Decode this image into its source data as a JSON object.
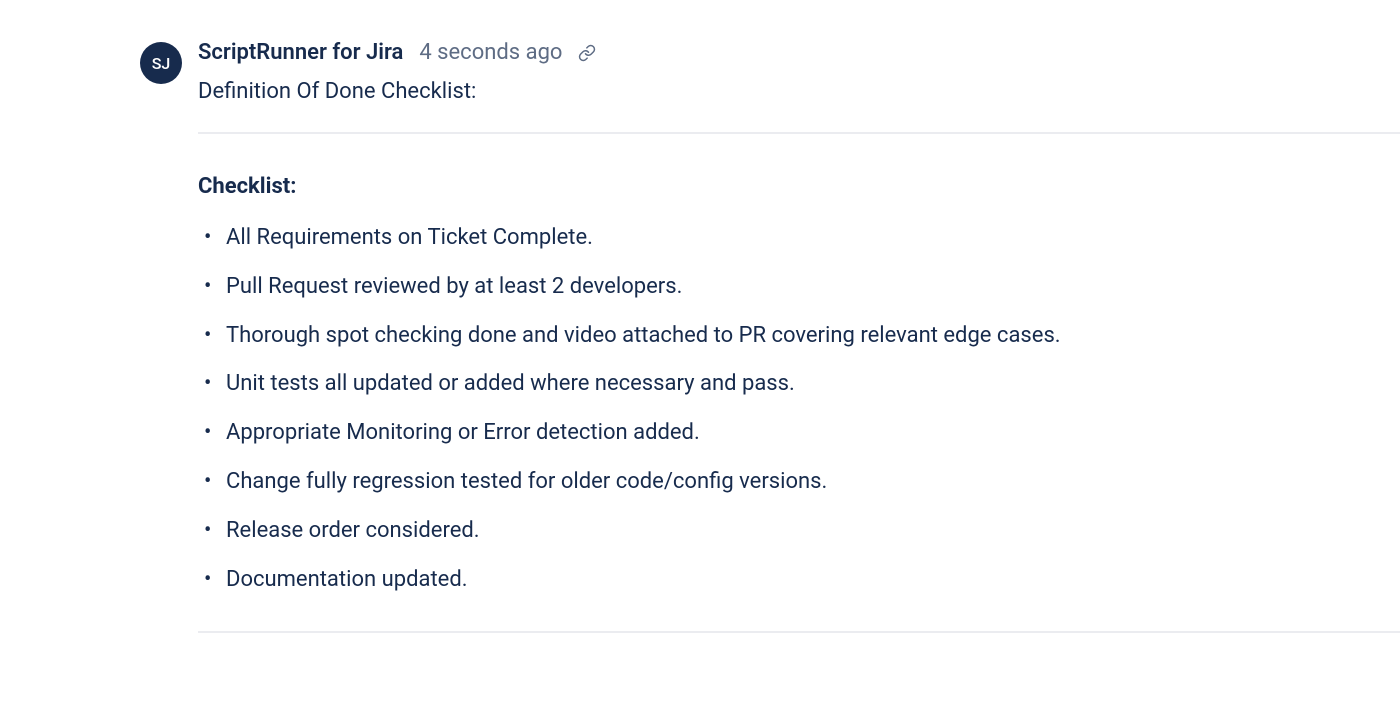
{
  "comment": {
    "avatar_initials": "SJ",
    "author": "ScriptRunner for Jira",
    "timestamp": "4 seconds ago",
    "intro": "Definition Of Done Checklist:",
    "checklist_heading": "Checklist:",
    "items": [
      "All Requirements on Ticket Complete.",
      "Pull Request reviewed by at least 2 developers.",
      "Thorough spot checking done and video attached to PR covering relevant edge cases.",
      "Unit tests all updated or added where necessary and pass.",
      "Appropriate Monitoring or Error detection added.",
      "Change fully regression tested for older code/config versions.",
      "Release order considered.",
      "Documentation updated."
    ]
  }
}
